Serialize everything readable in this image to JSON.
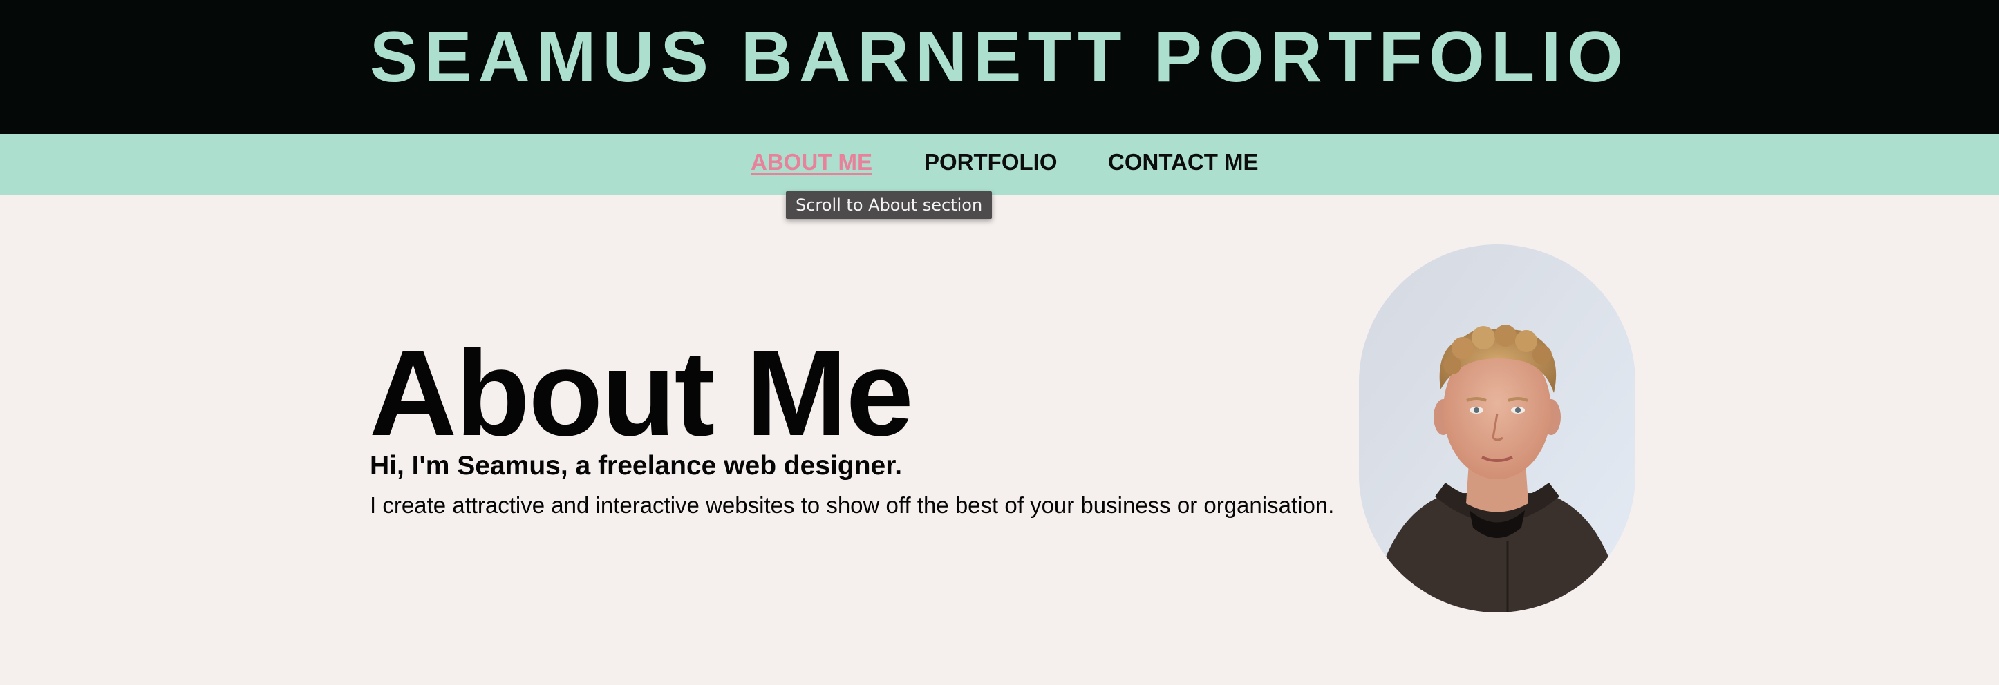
{
  "header": {
    "title": "SEAMUS BARNETT PORTFOLIO"
  },
  "nav": {
    "items": [
      {
        "label": "ABOUT ME",
        "active": true
      },
      {
        "label": "PORTFOLIO",
        "active": false
      },
      {
        "label": "CONTACT ME",
        "active": false
      }
    ],
    "tooltip": "Scroll to About section"
  },
  "about": {
    "heading": "About Me",
    "subheading": "Hi, I'm Seamus, a freelance web designer.",
    "text": "I create attractive and interactive websites to show off the best of your business or organisation."
  },
  "colors": {
    "header_bg": "#040806",
    "accent_mint": "#addfcf",
    "active_link": "#e8829b",
    "page_bg": "#f5efee"
  }
}
